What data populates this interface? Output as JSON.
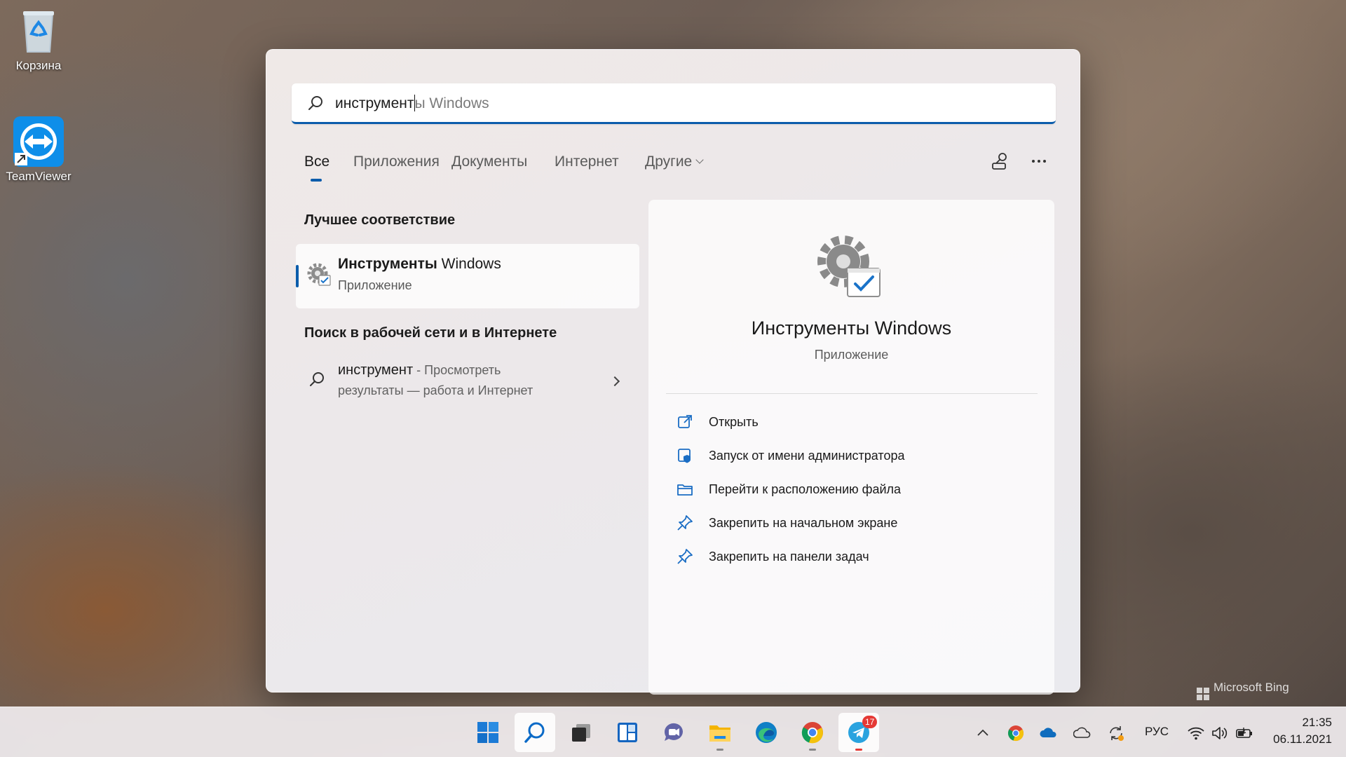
{
  "desktop": {
    "icons": [
      {
        "label": "Корзина"
      },
      {
        "label": "TeamViewer"
      }
    ],
    "watermark": "Microsoft Bing"
  },
  "search": {
    "query_typed": "инструмент",
    "query_autocomplete": "ы Windows"
  },
  "tabs": [
    {
      "label": "Все",
      "active": true
    },
    {
      "label": "Приложения"
    },
    {
      "label": "Документы"
    },
    {
      "label": "Интернет"
    },
    {
      "label": "Другие"
    }
  ],
  "results": {
    "best_match_heading": "Лучшее соответствие",
    "best_match": {
      "title_bold": "Инструменты",
      "title_rest": " Windows",
      "subtitle": "Приложение"
    },
    "web_heading": "Поиск в рабочей сети и в Интернете",
    "web_item": {
      "query": "инструмент",
      "suffix": " - Просмотреть",
      "line2": "результаты — работа и Интернет"
    }
  },
  "detail": {
    "title": "Инструменты Windows",
    "subtitle": "Приложение",
    "actions": [
      {
        "label": "Открыть",
        "icon": "open-icon"
      },
      {
        "label": "Запуск от имени администратора",
        "icon": "admin-shield-icon"
      },
      {
        "label": "Перейти к расположению файла",
        "icon": "folder-icon"
      },
      {
        "label": "Закрепить на начальном экране",
        "icon": "pin-icon"
      },
      {
        "label": "Закрепить на панели задач",
        "icon": "pin-icon"
      }
    ]
  },
  "taskbar": {
    "apps": [
      "start-icon",
      "search-icon",
      "task-view-icon",
      "widgets-icon",
      "teams-chat-icon",
      "file-explorer-icon",
      "edge-icon",
      "chrome-icon",
      "telegram-icon"
    ],
    "telegram_badge": "17",
    "language": "РУС",
    "time": "21:35",
    "date": "06.11.2021"
  },
  "colors": {
    "accent": "#0b5cab",
    "telegram_badge": "#e53935"
  }
}
